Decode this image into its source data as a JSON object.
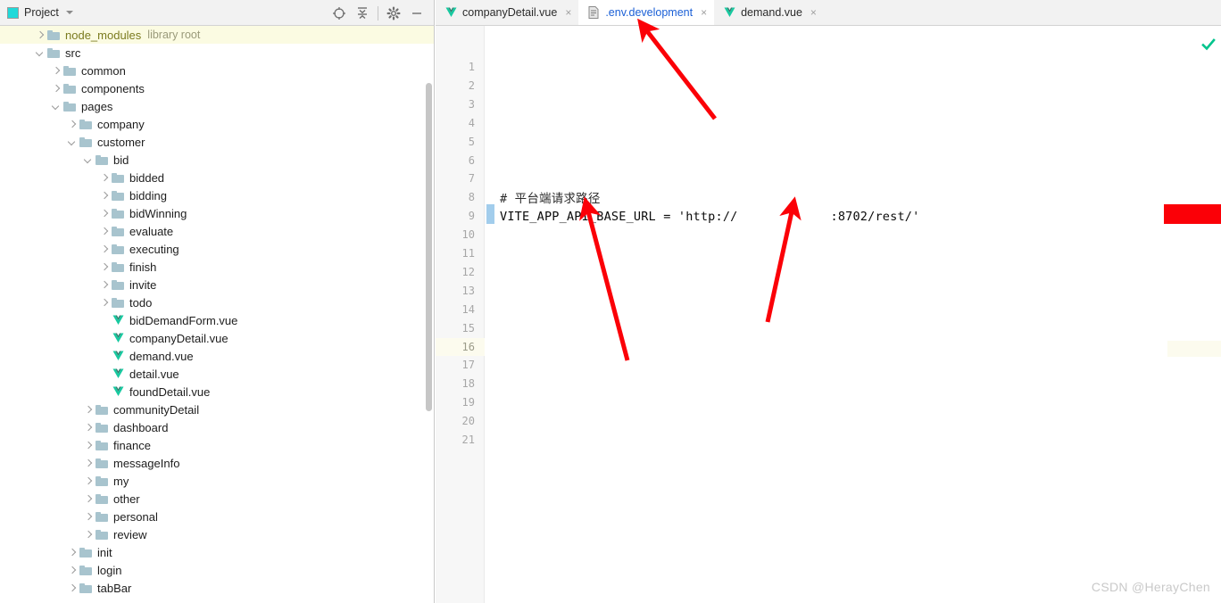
{
  "project_panel": {
    "title": "Project",
    "title_icon": "project-square-icon",
    "toolbar_buttons": [
      {
        "name": "select-opened-file-icon",
        "label": "Select Opened File"
      },
      {
        "name": "collapse-all-icon",
        "label": "Collapse All"
      },
      {
        "name": "gear-icon",
        "label": "Settings"
      },
      {
        "name": "minimize-icon",
        "label": "Hide"
      }
    ],
    "tree": [
      {
        "label": "node_modules",
        "sub": "library root",
        "kind": "folder",
        "depth": 1,
        "arrow": "collapsed",
        "highlight": true
      },
      {
        "label": "src",
        "sub": "",
        "kind": "folder",
        "depth": 1,
        "arrow": "expanded",
        "highlight": false
      },
      {
        "label": "common",
        "sub": "",
        "kind": "folder",
        "depth": 2,
        "arrow": "collapsed",
        "highlight": false
      },
      {
        "label": "components",
        "sub": "",
        "kind": "folder",
        "depth": 2,
        "arrow": "collapsed",
        "highlight": false
      },
      {
        "label": "pages",
        "sub": "",
        "kind": "folder",
        "depth": 2,
        "arrow": "expanded",
        "highlight": false
      },
      {
        "label": "company",
        "sub": "",
        "kind": "folder",
        "depth": 3,
        "arrow": "collapsed",
        "highlight": false
      },
      {
        "label": "customer",
        "sub": "",
        "kind": "folder",
        "depth": 3,
        "arrow": "expanded",
        "highlight": false
      },
      {
        "label": "bid",
        "sub": "",
        "kind": "folder",
        "depth": 4,
        "arrow": "expanded",
        "highlight": false
      },
      {
        "label": "bidded",
        "sub": "",
        "kind": "folder",
        "depth": 5,
        "arrow": "collapsed",
        "highlight": false
      },
      {
        "label": "bidding",
        "sub": "",
        "kind": "folder",
        "depth": 5,
        "arrow": "collapsed",
        "highlight": false
      },
      {
        "label": "bidWinning",
        "sub": "",
        "kind": "folder",
        "depth": 5,
        "arrow": "collapsed",
        "highlight": false
      },
      {
        "label": "evaluate",
        "sub": "",
        "kind": "folder",
        "depth": 5,
        "arrow": "collapsed",
        "highlight": false
      },
      {
        "label": "executing",
        "sub": "",
        "kind": "folder",
        "depth": 5,
        "arrow": "collapsed",
        "highlight": false
      },
      {
        "label": "finish",
        "sub": "",
        "kind": "folder",
        "depth": 5,
        "arrow": "collapsed",
        "highlight": false
      },
      {
        "label": "invite",
        "sub": "",
        "kind": "folder",
        "depth": 5,
        "arrow": "collapsed",
        "highlight": false
      },
      {
        "label": "todo",
        "sub": "",
        "kind": "folder",
        "depth": 5,
        "arrow": "collapsed",
        "highlight": false
      },
      {
        "label": "bidDemandForm.vue",
        "sub": "",
        "kind": "vue",
        "depth": 5,
        "arrow": "none",
        "highlight": false
      },
      {
        "label": "companyDetail.vue",
        "sub": "",
        "kind": "vue",
        "depth": 5,
        "arrow": "none",
        "highlight": false
      },
      {
        "label": "demand.vue",
        "sub": "",
        "kind": "vue",
        "depth": 5,
        "arrow": "none",
        "highlight": false
      },
      {
        "label": "detail.vue",
        "sub": "",
        "kind": "vue",
        "depth": 5,
        "arrow": "none",
        "highlight": false
      },
      {
        "label": "foundDetail.vue",
        "sub": "",
        "kind": "vue",
        "depth": 5,
        "arrow": "none",
        "highlight": false
      },
      {
        "label": "communityDetail",
        "sub": "",
        "kind": "folder",
        "depth": 4,
        "arrow": "collapsed",
        "highlight": false
      },
      {
        "label": "dashboard",
        "sub": "",
        "kind": "folder",
        "depth": 4,
        "arrow": "collapsed",
        "highlight": false
      },
      {
        "label": "finance",
        "sub": "",
        "kind": "folder",
        "depth": 4,
        "arrow": "collapsed",
        "highlight": false
      },
      {
        "label": "messageInfo",
        "sub": "",
        "kind": "folder",
        "depth": 4,
        "arrow": "collapsed",
        "highlight": false
      },
      {
        "label": "my",
        "sub": "",
        "kind": "folder",
        "depth": 4,
        "arrow": "collapsed",
        "highlight": false
      },
      {
        "label": "other",
        "sub": "",
        "kind": "folder",
        "depth": 4,
        "arrow": "collapsed",
        "highlight": false
      },
      {
        "label": "personal",
        "sub": "",
        "kind": "folder",
        "depth": 4,
        "arrow": "collapsed",
        "highlight": false
      },
      {
        "label": "review",
        "sub": "",
        "kind": "folder",
        "depth": 4,
        "arrow": "collapsed",
        "highlight": false
      },
      {
        "label": "init",
        "sub": "",
        "kind": "folder",
        "depth": 3,
        "arrow": "collapsed",
        "highlight": false
      },
      {
        "label": "login",
        "sub": "",
        "kind": "folder",
        "depth": 3,
        "arrow": "collapsed",
        "highlight": false
      },
      {
        "label": "tabBar",
        "sub": "",
        "kind": "folder",
        "depth": 3,
        "arrow": "collapsed",
        "highlight": false
      }
    ]
  },
  "editor": {
    "tabs": [
      {
        "label": "companyDetail.vue",
        "icon": "vue-file-icon",
        "active": false,
        "close": "×"
      },
      {
        "label": ".env.development",
        "icon": "properties-file-icon",
        "active": true,
        "close": "×"
      },
      {
        "label": "demand.vue",
        "icon": "vue-file-icon",
        "active": false,
        "close": "×"
      }
    ],
    "line_numbers": [
      "1",
      "2",
      "3",
      "4",
      "5",
      "6",
      "7",
      "8",
      "9",
      "10",
      "11",
      "12",
      "13",
      "14",
      "15",
      "16",
      "17",
      "18",
      "19",
      "20",
      "21"
    ],
    "caret_line": "16",
    "changed_line": "9",
    "code": {
      "line8": "# 平台端请求路径",
      "line9_prefix": "VITE_APP_API_BASE_URL = 'http://",
      "line9_suffix": ":8702/rest/'"
    },
    "inspection_status": "no-problems-check-icon"
  },
  "annotations": {
    "arrow_color": "#fb0007",
    "arrows": [
      {
        "name": "arrow-to-env-development-tab",
        "points_at": ".env.development tab"
      },
      {
        "name": "arrow-to-env-variable-name",
        "points_at": "VITE_APP_API_BASE_URL"
      },
      {
        "name": "arrow-to-redacted-host",
        "points_at": "redacted host address"
      }
    ],
    "redaction": {
      "name": "redacted-host-block",
      "color": "#fb0007"
    }
  },
  "watermark": {
    "text": "CSDN @HerayChen"
  }
}
